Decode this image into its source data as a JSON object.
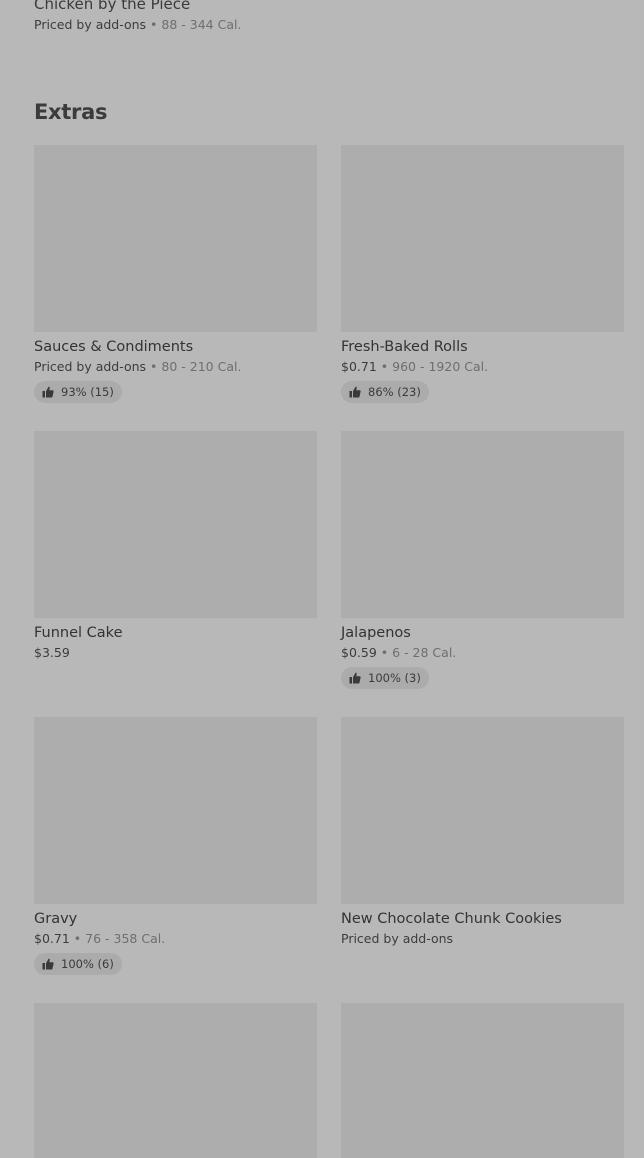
{
  "top_item": {
    "name": "Chicken by the Piece",
    "price": "Priced by add-ons",
    "separator": "•",
    "calories": "88 - 344 Cal."
  },
  "section": {
    "title": "Extras"
  },
  "items": [
    {
      "name": "Sauces & Condiments",
      "price": "Priced by add-ons",
      "separator": "•",
      "calories": "80 - 210 Cal.",
      "rating": "93% (15)"
    },
    {
      "name": "Fresh-Baked Rolls",
      "price": "$0.71",
      "separator": "•",
      "calories": "960 - 1920 Cal.",
      "rating": "86% (23)"
    },
    {
      "name": "Funnel Cake",
      "price": "$3.59"
    },
    {
      "name": "Jalapenos",
      "price": "$0.59",
      "separator": "•",
      "calories": "6 - 28 Cal.",
      "rating": "100% (3)"
    },
    {
      "name": "Gravy",
      "price": "$0.71",
      "separator": "•",
      "calories": "76 - 358 Cal.",
      "rating": "100% (6)"
    },
    {
      "name": "New Chocolate  Chunk Cookies",
      "price": "Priced by add-ons"
    }
  ],
  "icons": {
    "rating": "thumbs-up-icon"
  },
  "colors": {
    "overlay_background": "#b8b8b8",
    "image_placeholder": "#adadad",
    "rating_badge": "#ababab"
  }
}
